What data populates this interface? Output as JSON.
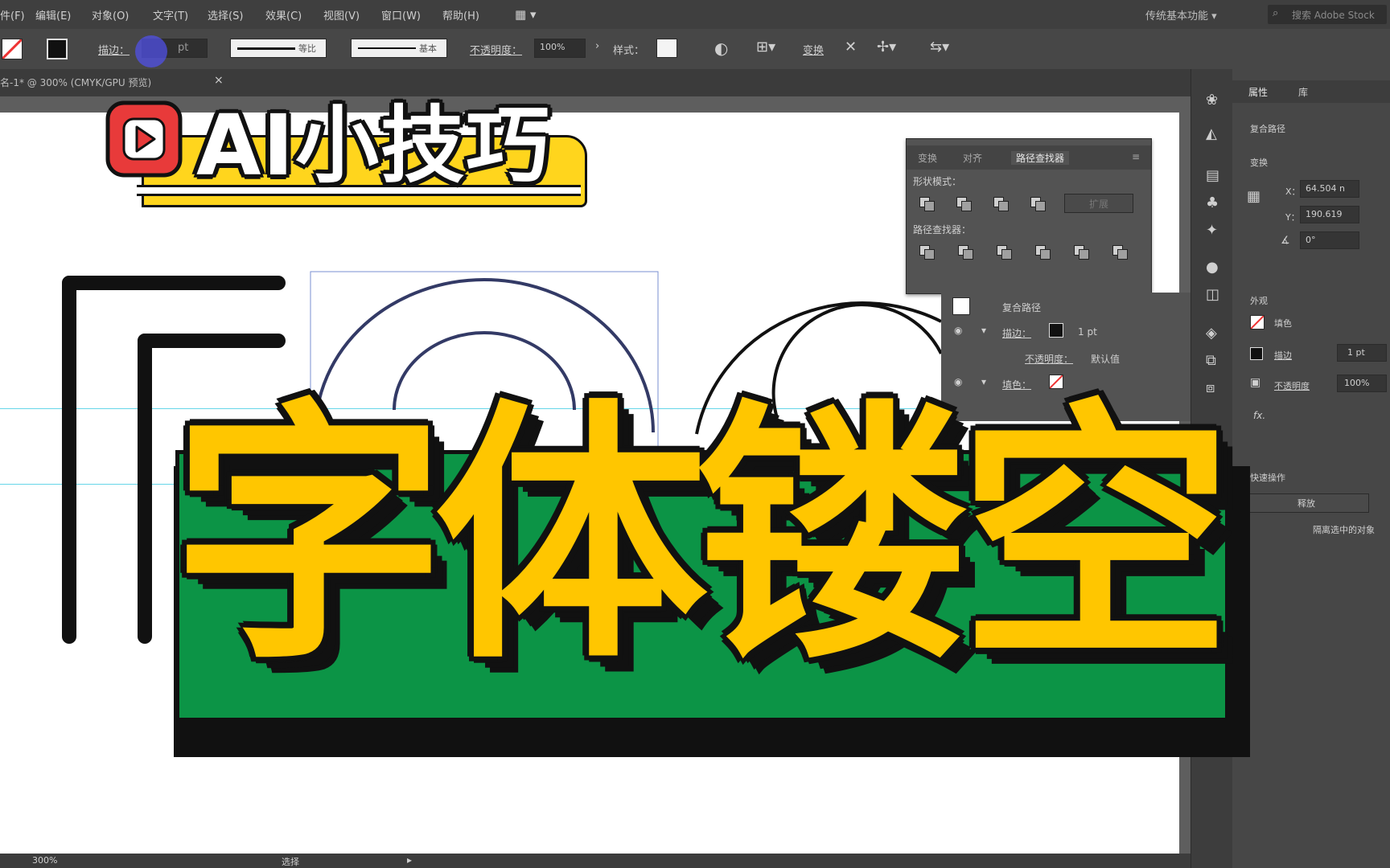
{
  "menu": {
    "items": [
      "件(F)",
      "编辑(E)",
      "对象(O)",
      "文字(T)",
      "选择(S)",
      "效果(C)",
      "视图(V)",
      "窗口(W)",
      "帮助(H)"
    ],
    "workspace_label": "传统基本功能",
    "search_placeholder": "搜索 Adobe Stock"
  },
  "control": {
    "stroke_label": "描边：",
    "stroke_value": "pt",
    "profile1_label": "等比",
    "profile2_label": "基本",
    "opacity_label": "不透明度：",
    "opacity_value": "100%",
    "style_label": "样式：",
    "transform_label": "变换"
  },
  "doc_tab": "名-1* @ 300% (CMYK/GPU 预览)",
  "pathfinder": {
    "tabs": [
      "变换",
      "对齐",
      "路径查找器"
    ],
    "shape_modes_label": "形状模式：",
    "expand_label": "扩展",
    "pathfinders_label": "路径查找器："
  },
  "appearance": {
    "compound_path_label": "复合路径",
    "stroke_label": "描边：",
    "stroke_value": "1 pt",
    "opacity_label": "不透明度：",
    "opacity_value": "默认值",
    "fill_label": "填色："
  },
  "properties": {
    "tabs": [
      "属性",
      "库"
    ],
    "section_compound": "复合路径",
    "section_transform": "变换",
    "x_label": "X：",
    "x_value": "64.504 n",
    "y_label": "Y：",
    "y_value": "190.619",
    "angle_value": "0°",
    "appearance_title": "外观",
    "fill_label": "填色",
    "stroke_label": "描边",
    "stroke_value": "1 pt",
    "opacity_label": "不透明度",
    "opacity_value": "100%",
    "quick_actions": "快速操作",
    "release_button": "释放",
    "isolate_button": "隔离选中的对象"
  },
  "overlay": {
    "badge_text": "AI小技巧",
    "title_text": "字体镂空",
    "colors": {
      "yellow": "#ffc600",
      "green": "#0c9446",
      "badge_yellow": "#ffd51d",
      "play_red": "#e83a3a"
    }
  },
  "status": {
    "zoom_value": "300%",
    "tool_label": "选择"
  }
}
